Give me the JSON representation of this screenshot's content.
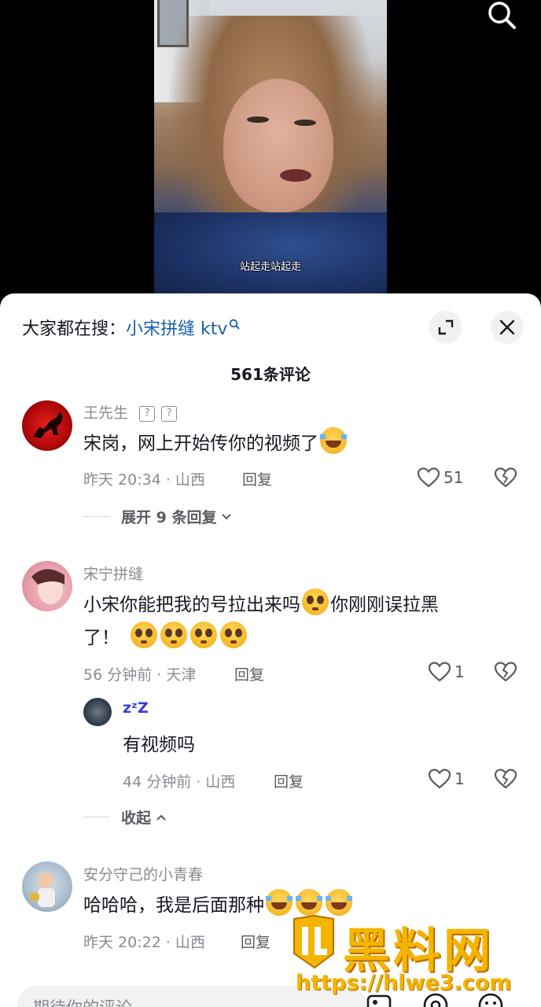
{
  "video": {
    "subtitle": "站起走站起走"
  },
  "sheet": {
    "search_prefix": "大家都在搜：",
    "search_term": "小宋拼缝 ktv",
    "comment_count": "561条评论"
  },
  "comments": [
    {
      "username": "王先生",
      "badges": [
        "?",
        "?"
      ],
      "text": "宋岗，网上开始传你的视频了",
      "time_location": "昨天 20:34 · 山西",
      "reply_label": "回复",
      "likes": "51",
      "expand_label": "展开 9 条回复"
    },
    {
      "username": "宋宁拼缝",
      "text_line1": "小宋你能把我的号拉出来吗",
      "text_line1b": "你刚刚误拉黑",
      "text_line2": "了！",
      "time_location": "56 分钟前 · 天津",
      "reply_label": "回复",
      "likes": "1",
      "reply": {
        "username": "zᶻZ",
        "text": "有视频吗",
        "time_location": "44 分钟前 · 山西",
        "reply_label": "回复",
        "likes": "1"
      },
      "collapse_label": "收起"
    },
    {
      "username": "安分守己的小青春",
      "text": "哈哈哈，我是后面那种",
      "time_location": "昨天 20:22 · 山西",
      "reply_label": "回复"
    }
  ],
  "composer": {
    "placeholder": "期待你的评论"
  },
  "watermark": {
    "title": "黑料网",
    "url": "https://hlwe3.com"
  },
  "colors": {
    "accent_link": "#1a5fa8",
    "secondary_text": "#8a8b91",
    "watermark": "#f4b400"
  }
}
